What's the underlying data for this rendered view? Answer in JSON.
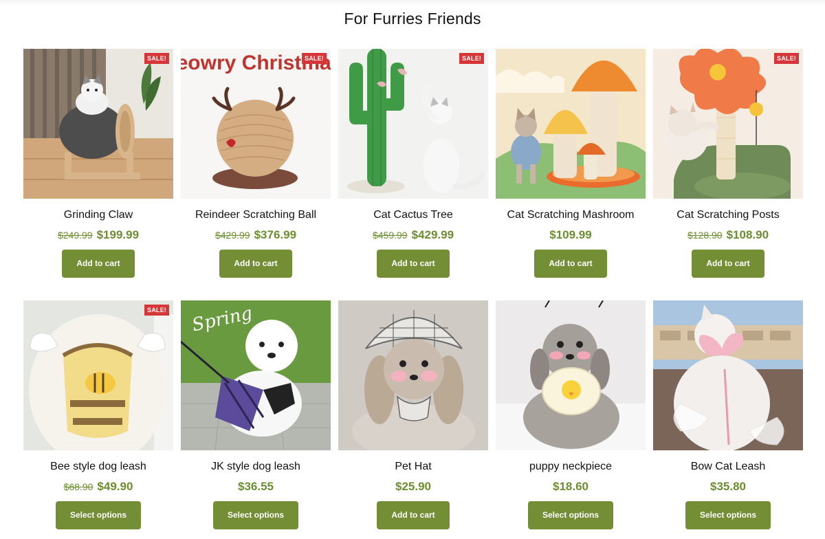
{
  "section": {
    "title": "For Furries Friends"
  },
  "colors": {
    "accent": "#748e35",
    "price": "#6b8e2e",
    "sale_badge": "#d63637"
  },
  "products": [
    {
      "name": "Grinding Claw",
      "old_price": "$249.99",
      "price": "$199.99",
      "sale": "SALE!",
      "button": "Add to cart"
    },
    {
      "name": "Reindeer Scratching Ball",
      "old_price": "$429.99",
      "price": "$376.99",
      "sale": "SALE!",
      "button": "Add to cart",
      "image_text": "Meowry Christmas"
    },
    {
      "name": "Cat Cactus Tree",
      "old_price": "$459.99",
      "price": "$429.99",
      "sale": "SALE!",
      "button": "Add to cart"
    },
    {
      "name": "Cat Scratching Mashroom",
      "old_price": "",
      "price": "$109.99",
      "sale": "",
      "button": "Add to cart"
    },
    {
      "name": "Cat Scratching Posts",
      "old_price": "$128.90",
      "price": "$108.90",
      "sale": "SALE!",
      "button": "Add to cart"
    },
    {
      "name": "Bee style dog leash",
      "old_price": "$68.90",
      "price": "$49.90",
      "sale": "SALE!",
      "button": "Select options"
    },
    {
      "name": "JK style dog leash",
      "old_price": "",
      "price": "$36.55",
      "sale": "",
      "button": "Select options",
      "image_text": "Spring"
    },
    {
      "name": "Pet Hat",
      "old_price": "",
      "price": "$25.90",
      "sale": "",
      "button": "Add to cart"
    },
    {
      "name": "puppy neckpiece",
      "old_price": "",
      "price": "$18.60",
      "sale": "",
      "button": "Select options"
    },
    {
      "name": "Bow Cat Leash",
      "old_price": "",
      "price": "$35.80",
      "sale": "",
      "button": "Select options"
    }
  ]
}
